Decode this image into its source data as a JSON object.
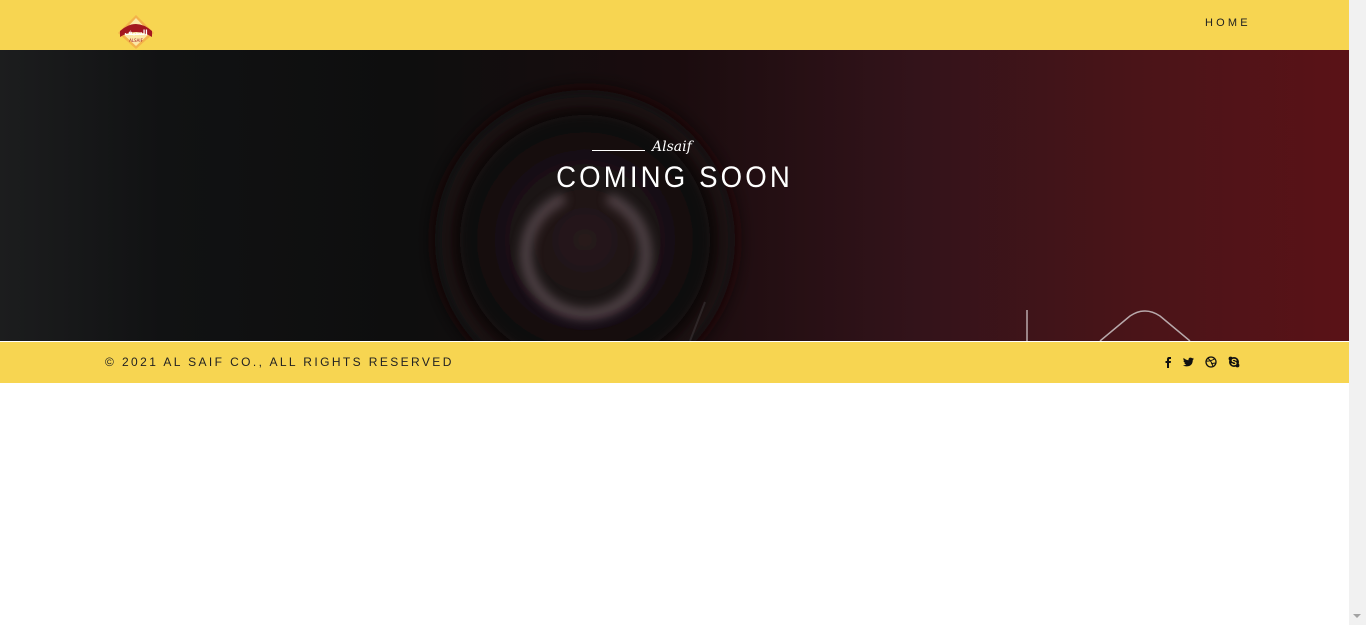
{
  "header": {
    "logo_label": "السيف",
    "logo_sublabel": "ALSAIF",
    "nav": {
      "home_label": "HOME"
    }
  },
  "hero": {
    "kicker": "Alsaif",
    "title": "COMING SOON"
  },
  "footer": {
    "copyright": "© 2021 AL SAIF CO., ALL RIGHTS RESERVED",
    "social": [
      "facebook-icon",
      "twitter-icon",
      "dribbble-icon",
      "skype-icon"
    ]
  },
  "colors": {
    "brand_yellow": "#f7d551",
    "brand_red": "#a3171f",
    "hero_dark": "#0e0e0e",
    "hero_red": "#5a1217"
  }
}
